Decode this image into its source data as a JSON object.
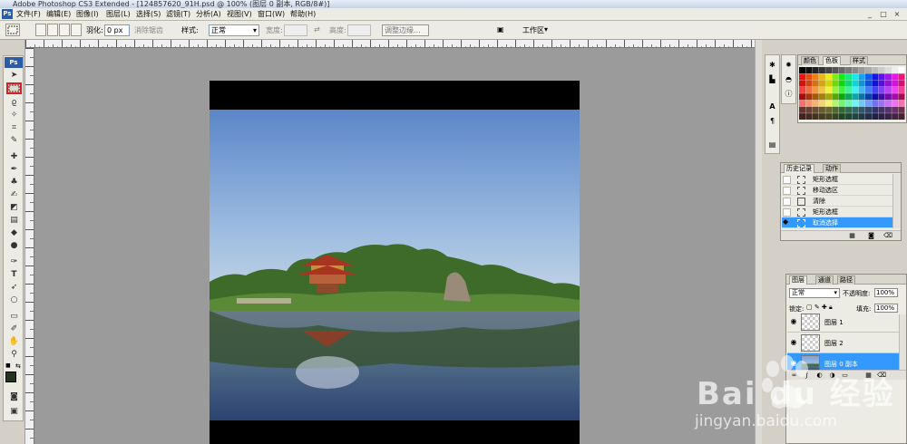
{
  "app": {
    "title": "Adobe Photoshop CS3 Extended - [124857620_91H.psd @ 100% (图层 0 副本, RGB/8#)]",
    "ps_label": "Ps"
  },
  "menu": [
    "文件(F)",
    "编辑(E)",
    "图像(I)",
    "图层(L)",
    "选择(S)",
    "滤镜(T)",
    "分析(A)",
    "视图(V)",
    "窗口(W)",
    "帮助(H)"
  ],
  "window_controls": [
    "_",
    "□",
    "×"
  ],
  "options": {
    "feather_label": "羽化:",
    "feather_value": "0 px",
    "antialias_label": "消除锯齿",
    "style_label": "样式:",
    "style_value": "正常",
    "width_label": "宽度:",
    "height_label": "高度:",
    "refine_edge": "调整边缘...",
    "workspace": "工作区"
  },
  "tools": [
    "move",
    "marquee",
    "lasso",
    "magic-wand",
    "crop",
    "slice",
    "healing",
    "brush",
    "stamp",
    "history-brush",
    "eraser",
    "gradient",
    "blur",
    "dodge",
    "pen",
    "type",
    "path-select",
    "shape",
    "notes",
    "eyedropper",
    "hand",
    "zoom"
  ],
  "swatch_panel": {
    "tabs": [
      "颜色",
      "色板",
      "样式"
    ],
    "active": "色板"
  },
  "history_panel": {
    "tabs": [
      "历史记录",
      "动作"
    ],
    "items": [
      {
        "label": "矩形选框",
        "selected": false
      },
      {
        "label": "移动选区",
        "selected": false
      },
      {
        "label": "清除",
        "selected": false
      },
      {
        "label": "矩形选框",
        "selected": false
      },
      {
        "label": "取消选择",
        "selected": true
      }
    ]
  },
  "layers_panel": {
    "tabs": [
      "图层",
      "通道",
      "路径"
    ],
    "blend_mode": "正常",
    "opacity_label": "不透明度:",
    "opacity_value": "100%",
    "lock_label": "锁定:",
    "fill_label": "填充:",
    "fill_value": "100%",
    "layers": [
      {
        "name": "图层 1",
        "selected": false
      },
      {
        "name": "图层 2",
        "selected": false
      },
      {
        "name": "图层 0 副本",
        "selected": true
      }
    ]
  },
  "watermark": {
    "brand": "Bai du 经验",
    "url": "jingyan.baidu.com"
  }
}
